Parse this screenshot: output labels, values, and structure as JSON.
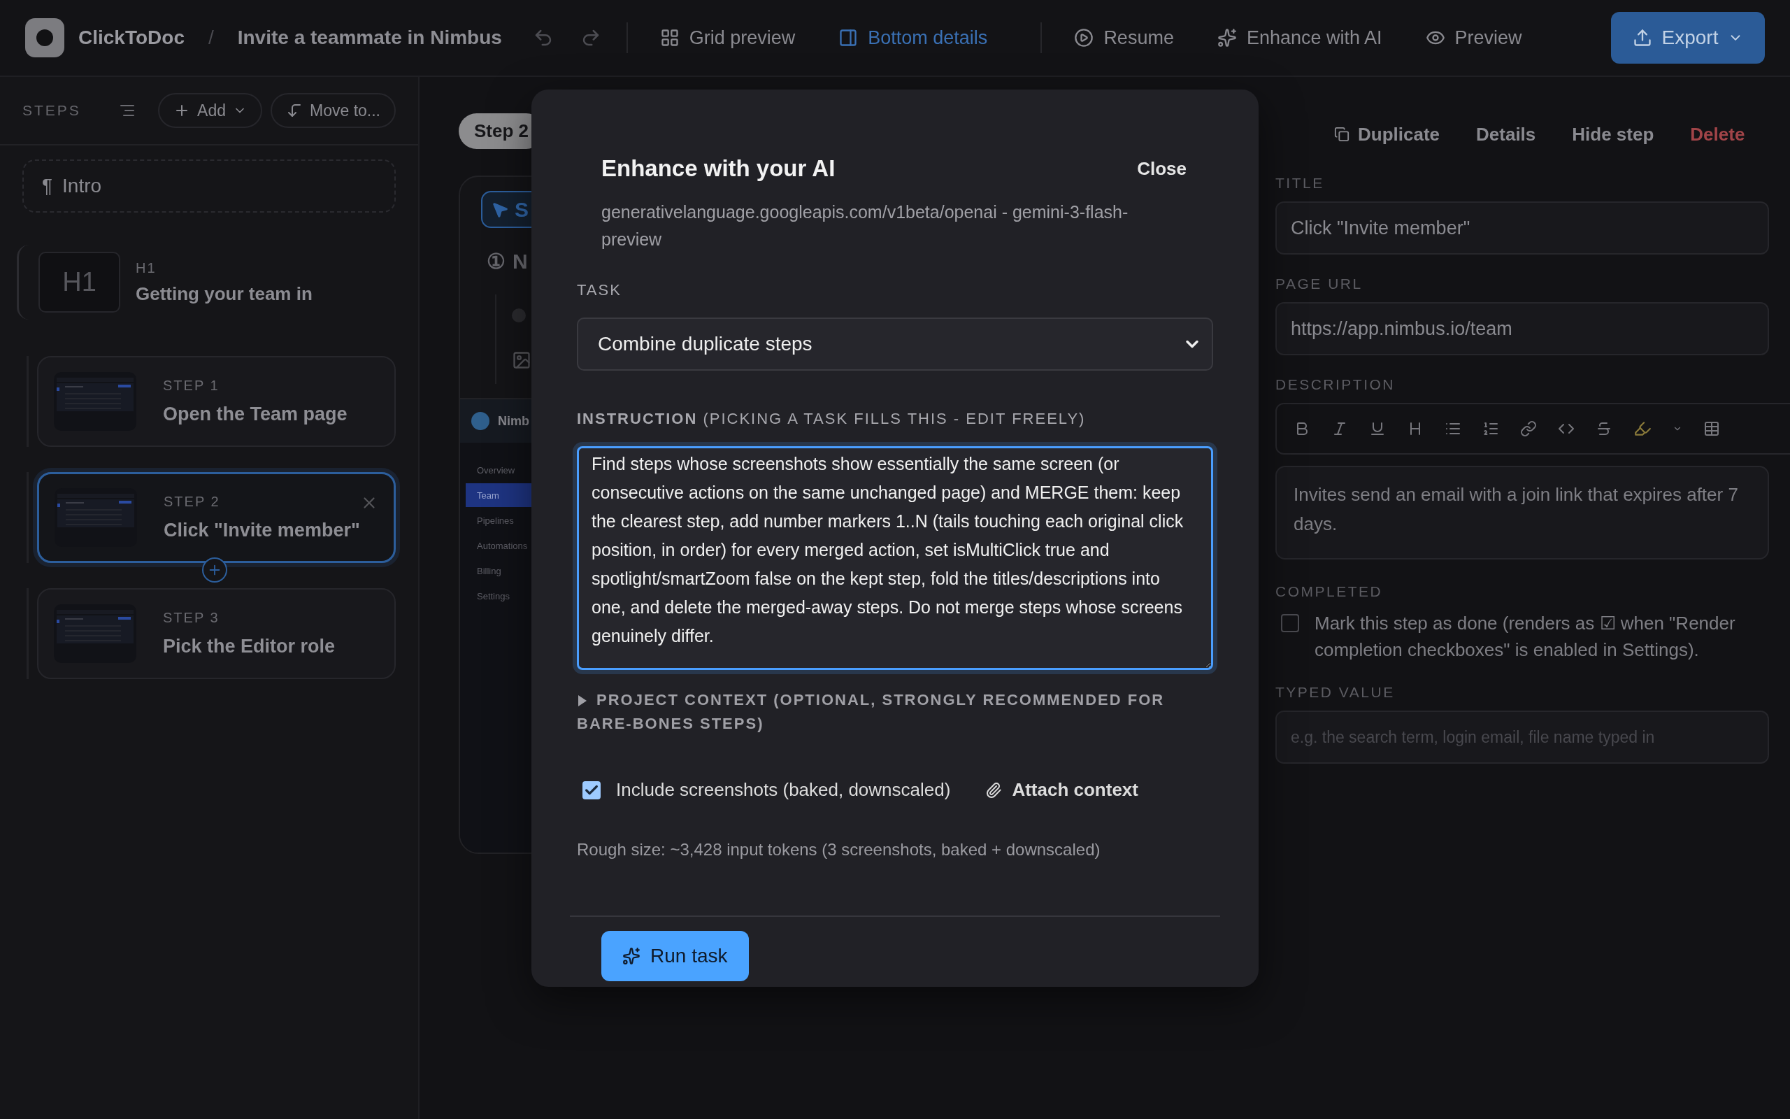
{
  "top_bar": {
    "app_name": "ClickToDoc",
    "separator": "/",
    "project_title": "Invite a teammate in Nimbus",
    "view_modes": [
      {
        "label": "Grid preview",
        "selected": false
      },
      {
        "label": "Bottom details",
        "selected": true
      }
    ],
    "actions": [
      "Resume",
      "Enhance with AI",
      "Preview"
    ],
    "export_button": "Export"
  },
  "sidebar": {
    "title": "STEPS",
    "add_button": "Add",
    "move_button": "Move to...",
    "intro": {
      "mark": "¶",
      "label": "Intro"
    },
    "items": [
      {
        "kind": "heading",
        "badge": "H1",
        "level": "H1",
        "title": "Getting your team in",
        "selected": false
      },
      {
        "kind": "step",
        "label": "STEP 1",
        "title": "Open the Team page",
        "selected": false
      },
      {
        "kind": "step",
        "label": "STEP 2",
        "title": "Click \"Invite member\"",
        "selected": true
      },
      {
        "kind": "step",
        "label": "STEP 3",
        "title": "Pick the Editor role",
        "selected": false
      }
    ]
  },
  "canvas": {
    "step_pill": "Step 2",
    "action_label": "S",
    "marker": "①",
    "marker_title": "N",
    "app_name": "Nimb",
    "nav": [
      {
        "label": "Overview",
        "selected": false
      },
      {
        "label": "Team",
        "selected": true
      },
      {
        "label": "Pipelines",
        "selected": false
      },
      {
        "label": "Automations",
        "selected": false
      },
      {
        "label": "Billing",
        "selected": false
      },
      {
        "label": "Settings",
        "selected": false
      }
    ]
  },
  "modal": {
    "title": "Enhance with your AI",
    "close_button": "Close",
    "endpoint": "generativelanguage.googleapis.com/v1beta/openai - gemini-3-flash-preview",
    "task_label": "TASK",
    "task_value": "Combine duplicate steps",
    "instruction_label": "**INSTRUCTION** (PICKING A TASK FILLS THIS - EDIT FREELY)",
    "instruction": "Find steps whose screenshots show essentially the same screen (or consecutive actions on the same unchanged page) and MERGE them: keep the clearest step, add number markers 1..N (tails touching each original click position, in order) for every merged action, set isMultiClick true and spotlight/smartZoom false on the kept step, fold the titles/descriptions into one, and delete the merged-away steps. Do not merge steps whose screens genuinely differ.",
    "project_context": {
      "label": "PROJECT CONTEXT (OPTIONAL, STRONGLY RECOMMENDED FOR BARE-BONES STEPS)",
      "expanded": false
    },
    "include_screenshots": {
      "label": "Include screenshots (baked, downscaled)",
      "checked": true
    },
    "attach_button": "Attach context",
    "size_note": "Rough size: ~3,428 input tokens (3 screenshots, baked + downscaled)",
    "run_button": "Run task"
  },
  "details": {
    "actions": [
      {
        "label": "Duplicate",
        "kind": "icon"
      },
      {
        "label": "Details",
        "kind": "plain"
      },
      {
        "label": "Hide step",
        "kind": "plain"
      },
      {
        "label": "Delete",
        "kind": "danger"
      }
    ],
    "title_label": "TITLE",
    "title_value": "Click \"Invite member\"",
    "url_label": "PAGE URL",
    "url_value": "https://app.nimbus.io/team",
    "description_label": "DESCRIPTION",
    "description": "Invites send an email with a join link that expires after 7 days.",
    "completed_label": "COMPLETED",
    "completed": {
      "label": "Mark this step as done (renders as ☑ when \"Render completion checkboxes\" is enabled in Settings).",
      "checked": false
    },
    "typed_label": "TYPED VALUE",
    "typed_placeholder": "e.g. the search term, login email, file name typed in"
  }
}
